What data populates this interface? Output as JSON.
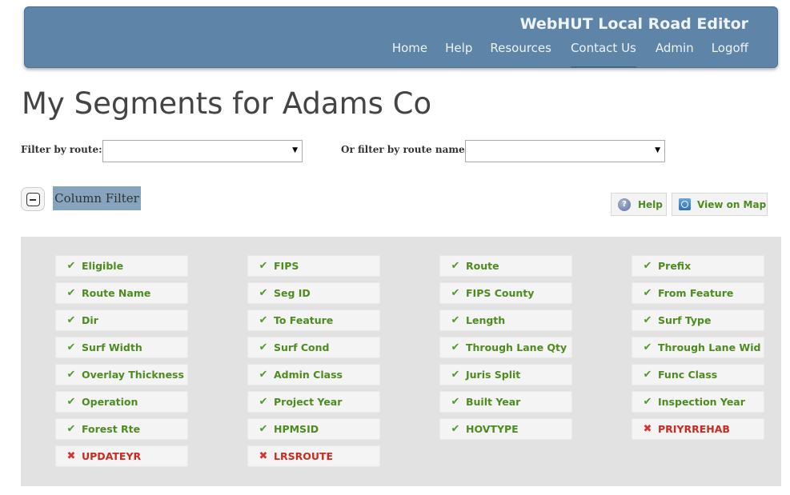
{
  "header": {
    "app_title": "WebHUT Local Road Editor",
    "nav": [
      "Home",
      "Help",
      "Resources",
      "Contact Us",
      "Admin",
      "Logoff"
    ],
    "active_nav": "Contact Us"
  },
  "page_title": "My Segments for Adams Co",
  "filters": {
    "route_label": "Filter by route:",
    "route_value": "",
    "route_name_label": "Or filter by route name:",
    "route_name_value": ""
  },
  "column_filter": {
    "label": "Column Filter",
    "toggle": "collapse"
  },
  "actions": {
    "help": "Help",
    "view_on_map": "View on Map"
  },
  "columns": [
    {
      "label": "Eligible",
      "enabled": true
    },
    {
      "label": "FIPS",
      "enabled": true
    },
    {
      "label": "Route",
      "enabled": true
    },
    {
      "label": "Prefix",
      "enabled": true
    },
    {
      "label": "Route Name",
      "enabled": true
    },
    {
      "label": "Seg ID",
      "enabled": true
    },
    {
      "label": "FIPS County",
      "enabled": true
    },
    {
      "label": "From Feature",
      "enabled": true
    },
    {
      "label": "Dir",
      "enabled": true
    },
    {
      "label": "To Feature",
      "enabled": true
    },
    {
      "label": "Length",
      "enabled": true
    },
    {
      "label": "Surf Type",
      "enabled": true
    },
    {
      "label": "Surf Width",
      "enabled": true
    },
    {
      "label": "Surf Cond",
      "enabled": true
    },
    {
      "label": "Through Lane Qty",
      "enabled": true
    },
    {
      "label": "Through Lane Wid",
      "enabled": true
    },
    {
      "label": "Overlay Thickness",
      "enabled": true
    },
    {
      "label": "Admin Class",
      "enabled": true
    },
    {
      "label": "Juris Split",
      "enabled": true
    },
    {
      "label": "Func Class",
      "enabled": true
    },
    {
      "label": "Operation",
      "enabled": true
    },
    {
      "label": "Project Year",
      "enabled": true
    },
    {
      "label": "Built Year",
      "enabled": true
    },
    {
      "label": "Inspection Year",
      "enabled": true
    },
    {
      "label": "Forest Rte",
      "enabled": true
    },
    {
      "label": "HPMSID",
      "enabled": true
    },
    {
      "label": "HOVTYPE",
      "enabled": true
    },
    {
      "label": "PRIYRREHAB",
      "enabled": false
    },
    {
      "label": "UPDATEYR",
      "enabled": false
    },
    {
      "label": "LRSROUTE",
      "enabled": false
    }
  ],
  "colors": {
    "header_bg": "#5e84a8",
    "enabled_text": "#4d8c1f",
    "disabled_text": "#cc2a1e",
    "panel_bg": "#e2e2e2"
  }
}
